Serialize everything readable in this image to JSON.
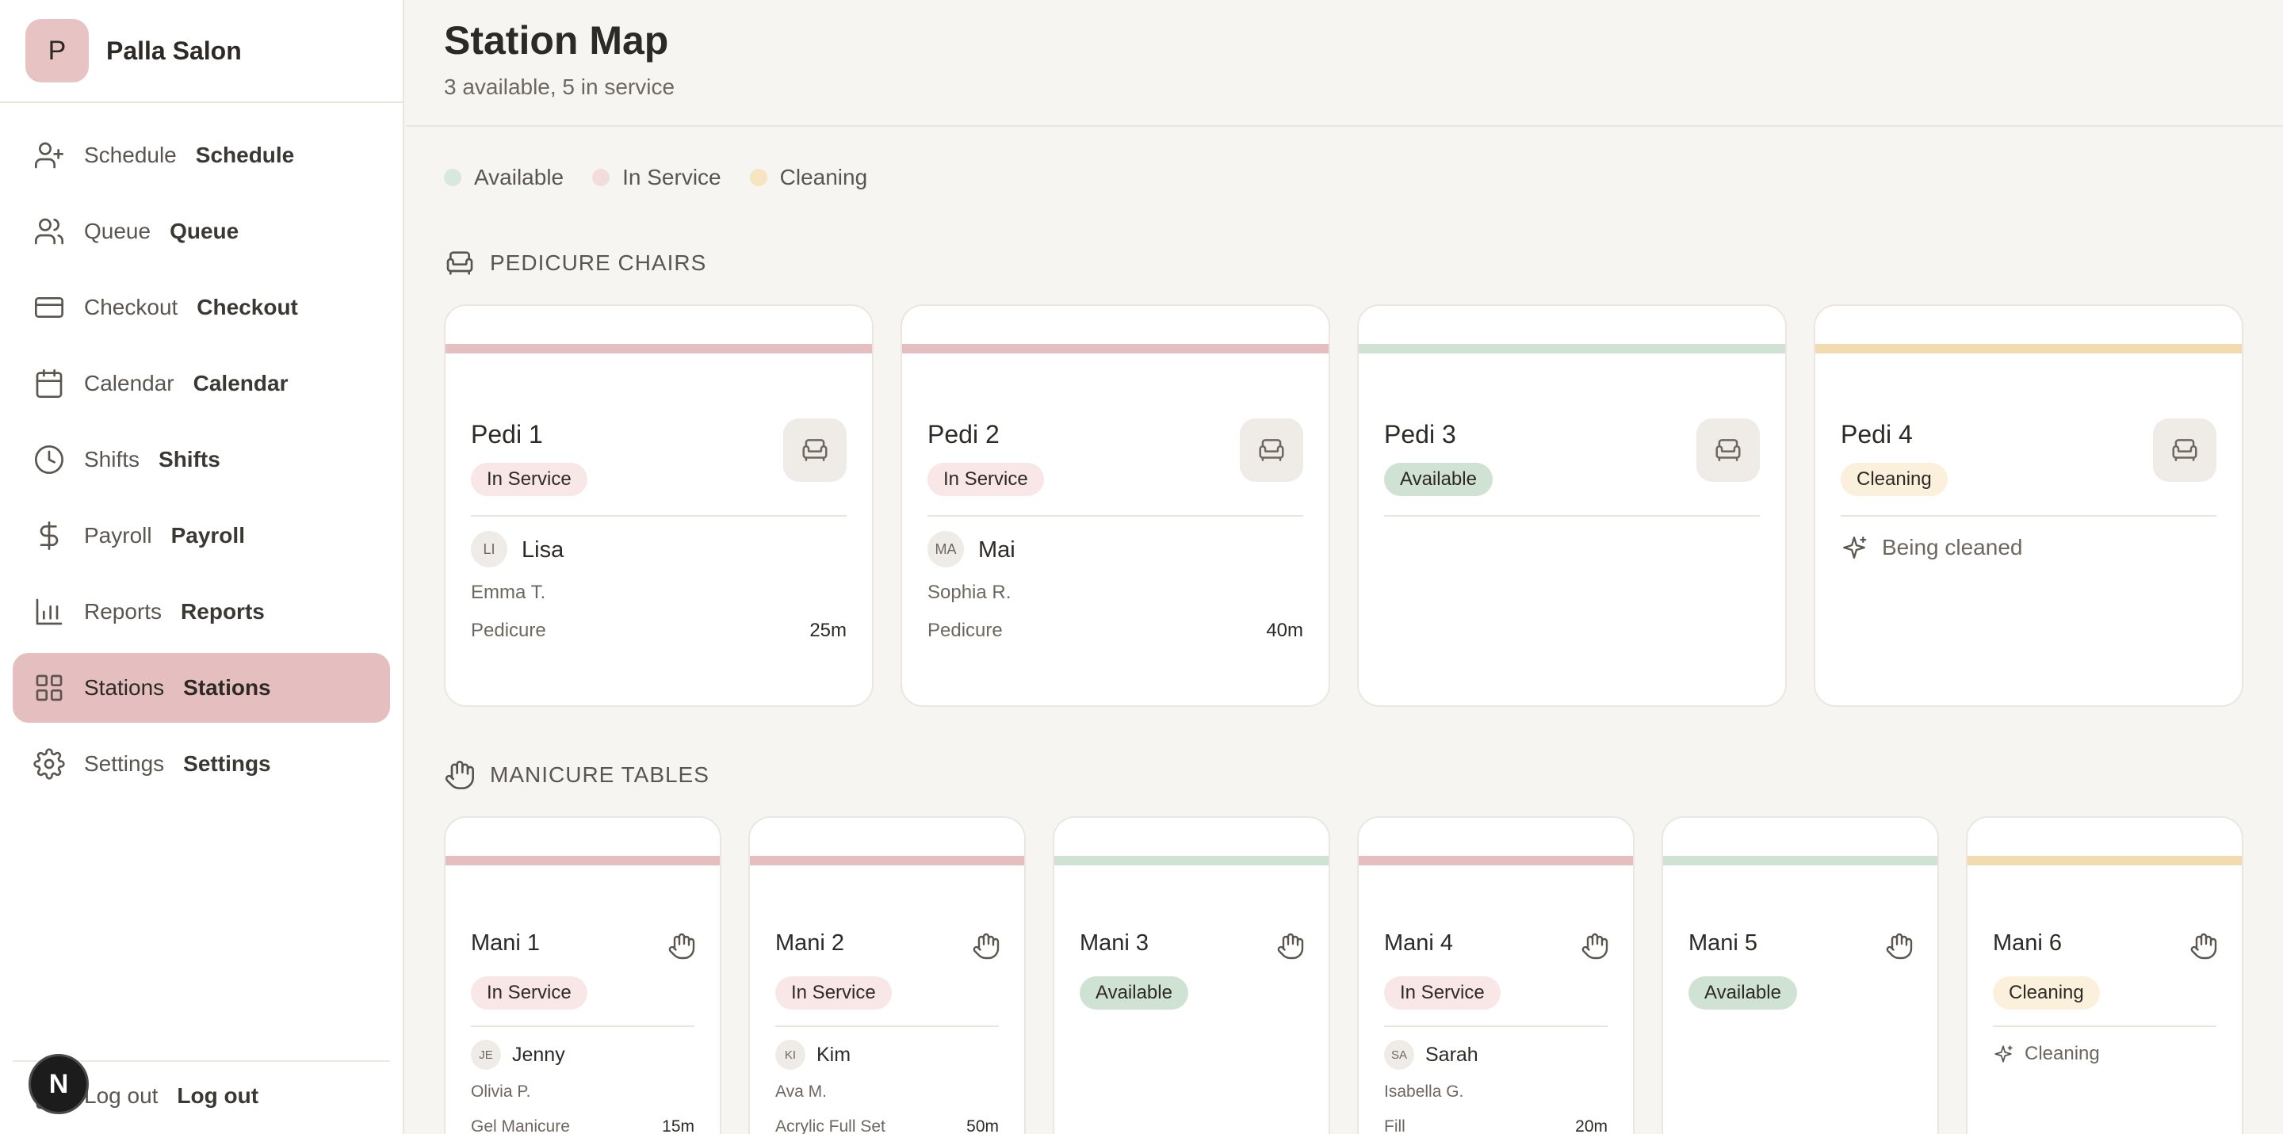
{
  "brand": {
    "initial": "P",
    "name": "Palla Salon"
  },
  "nav": [
    {
      "icon": "user-plus-icon",
      "label": "Schedule",
      "label2": "Schedule"
    },
    {
      "icon": "users-icon",
      "label": "Queue",
      "label2": "Queue"
    },
    {
      "icon": "credit-card-icon",
      "label": "Checkout",
      "label2": "Checkout"
    },
    {
      "icon": "calendar-icon",
      "label": "Calendar",
      "label2": "Calendar"
    },
    {
      "icon": "clock-icon",
      "label": "Shifts",
      "label2": "Shifts"
    },
    {
      "icon": "dollar-icon",
      "label": "Payroll",
      "label2": "Payroll"
    },
    {
      "icon": "bar-chart-icon",
      "label": "Reports",
      "label2": "Reports"
    },
    {
      "icon": "grid-icon",
      "label": "Stations",
      "label2": "Stations",
      "active": true
    },
    {
      "icon": "gear-icon",
      "label": "Settings",
      "label2": "Settings"
    }
  ],
  "logout": {
    "label": "Log out",
    "label2": "Log out"
  },
  "n_badge": "N",
  "header": {
    "title": "Station Map",
    "subtitle": "3 available, 5 in service"
  },
  "colors": {
    "available": "#cfe2d4",
    "in_service": "#e5bfc0",
    "cleaning": "#f3dbb0"
  },
  "legend": [
    {
      "label": "Available",
      "color": "#d8e8dc"
    },
    {
      "label": "In Service",
      "color": "#f3dcdc"
    },
    {
      "label": "Cleaning",
      "color": "#f7e4c0"
    }
  ],
  "sections": {
    "pedi": {
      "title": "PEDICURE CHAIRS"
    },
    "mani": {
      "title": "MANICURE TABLES"
    }
  },
  "pedi": [
    {
      "name": "Pedi 1",
      "status": "In Service",
      "tech_initials": "LI",
      "tech": "Lisa",
      "client": "Emma T.",
      "service": "Pedicure",
      "duration": "25m"
    },
    {
      "name": "Pedi 2",
      "status": "In Service",
      "tech_initials": "MA",
      "tech": "Mai",
      "client": "Sophia R.",
      "service": "Pedicure",
      "duration": "40m"
    },
    {
      "name": "Pedi 3",
      "status": "Available"
    },
    {
      "name": "Pedi 4",
      "status": "Cleaning",
      "note": "Being cleaned"
    }
  ],
  "mani": [
    {
      "name": "Mani 1",
      "status": "In Service",
      "tech_initials": "JE",
      "tech": "Jenny",
      "client": "Olivia P.",
      "service": "Gel Manicure",
      "duration": "15m"
    },
    {
      "name": "Mani 2",
      "status": "In Service",
      "tech_initials": "KI",
      "tech": "Kim",
      "client": "Ava M.",
      "service": "Acrylic Full Set",
      "duration": "50m"
    },
    {
      "name": "Mani 3",
      "status": "Available"
    },
    {
      "name": "Mani 4",
      "status": "In Service",
      "tech_initials": "SA",
      "tech": "Sarah",
      "client": "Isabella G.",
      "service": "Fill",
      "duration": "20m"
    },
    {
      "name": "Mani 5",
      "status": "Available"
    },
    {
      "name": "Mani 6",
      "status": "Cleaning",
      "note": "Cleaning"
    }
  ]
}
